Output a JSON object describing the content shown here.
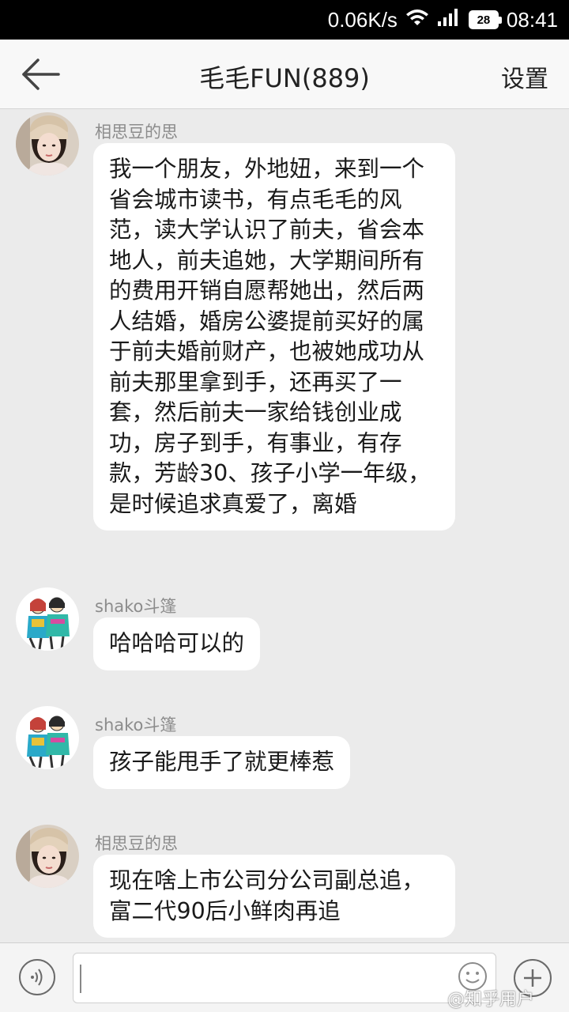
{
  "status_bar": {
    "speed": "0.06K/s",
    "battery": "28",
    "time": "08:41"
  },
  "header": {
    "title": "毛毛FUN(889)",
    "settings_label": "设置"
  },
  "messages": [
    {
      "sender": "相思豆的思",
      "avatar": "female-avatar",
      "text": "我一个朋友，外地妞，来到一个省会城市读书，有点毛毛的风范，读大学认识了前夫，省会本地人，前夫追她，大学期间所有的费用开销自愿帮她出，然后两人结婚，婚房公婆提前买好的属于前夫婚前财产，也被她成功从前夫那里拿到手，还再买了一套，然后前夫一家给钱创业成功，房子到手，有事业，有存款，芳龄30、孩子小学一年级，是时候追求真爱了，离婚"
    },
    {
      "sender": "shako斗篷",
      "avatar": "illustrated-couple-avatar",
      "text": "哈哈哈可以的"
    },
    {
      "sender": "shako斗篷",
      "avatar": "illustrated-couple-avatar",
      "text": "孩子能甩手了就更棒惹"
    },
    {
      "sender": "相思豆的思",
      "avatar": "female-avatar",
      "text": "现在啥上市公司分公司副总追，富二代90后小鲜肉再追"
    }
  ],
  "input_bar": {
    "input_value": "",
    "voice_icon": "voice-icon",
    "emoji_icon": "emoji-icon",
    "add_icon": "plus-icon"
  },
  "watermark": "@知乎用户",
  "colors": {
    "background": "#ebebeb",
    "bubble": "#ffffff",
    "header": "#f8f8f8",
    "status_bar": "#000000"
  }
}
